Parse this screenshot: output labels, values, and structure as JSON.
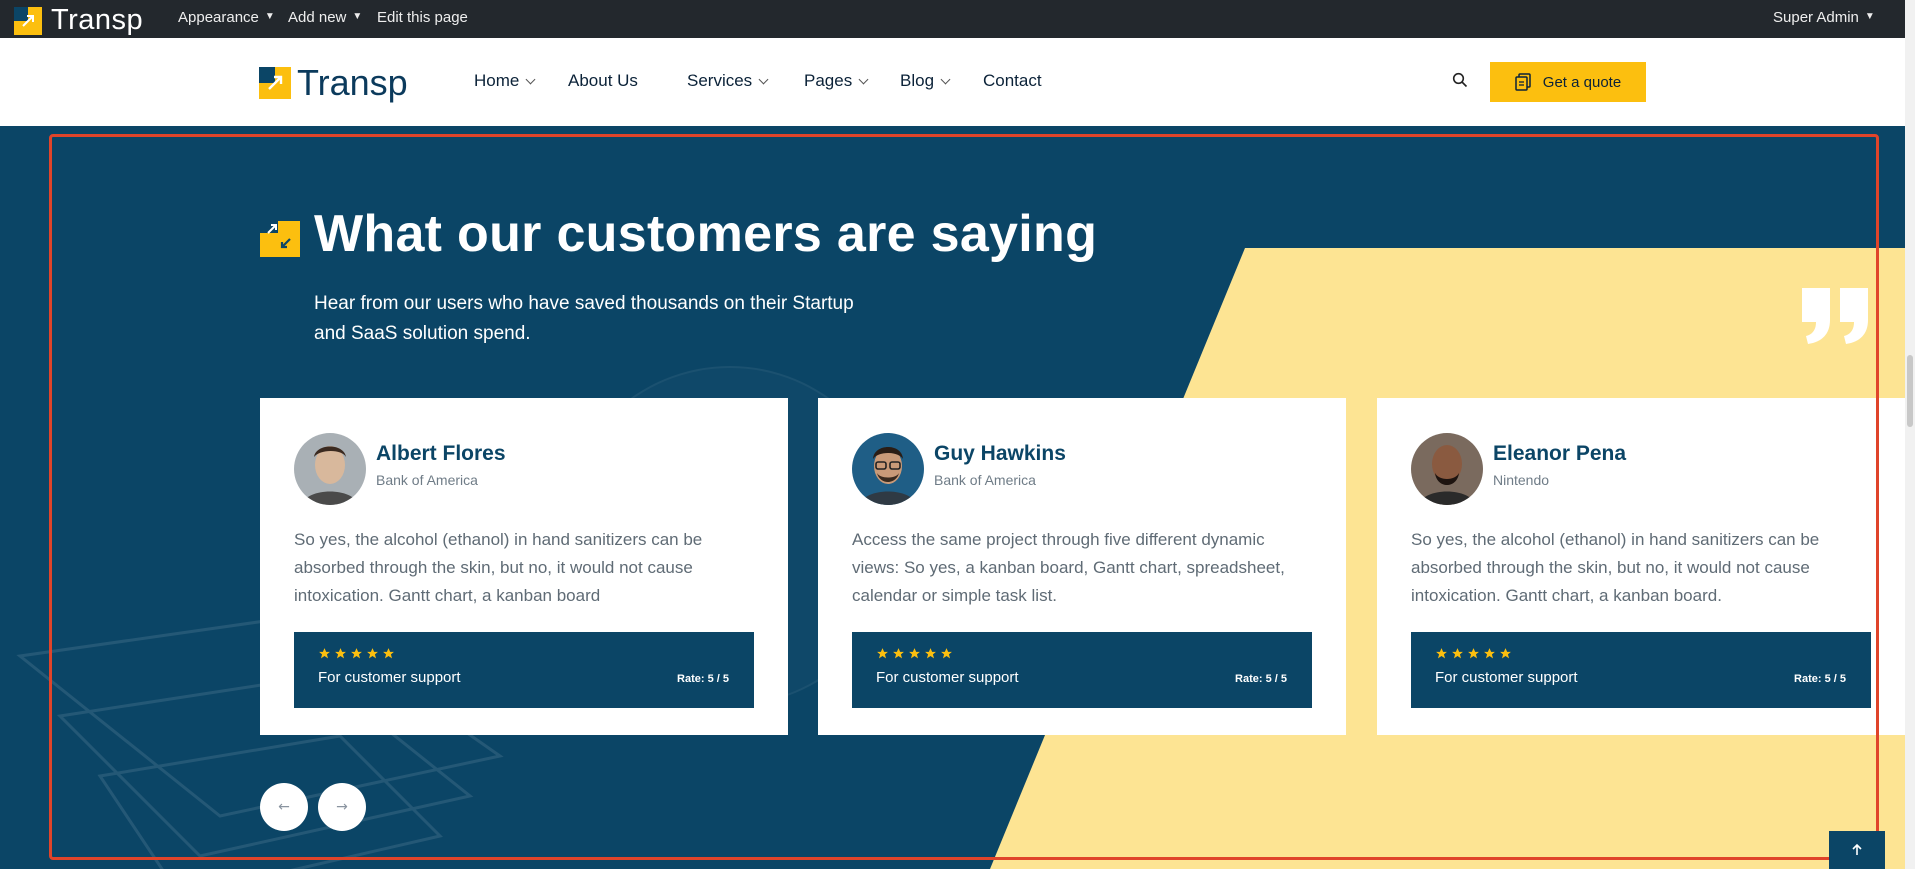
{
  "admin_bar": {
    "site_name": "Transp",
    "appearance": "Appearance",
    "add_new": "Add new",
    "edit_page": "Edit this page",
    "user": "Super Admin"
  },
  "header": {
    "brand": "Transp",
    "nav": [
      {
        "label": "Home"
      },
      {
        "label": "About Us"
      },
      {
        "label": "Services"
      },
      {
        "label": "Pages"
      },
      {
        "label": "Blog"
      },
      {
        "label": "Contact"
      }
    ],
    "quote_button": "Get a quote"
  },
  "section": {
    "title": "What our customers are saying",
    "subtitle": "Hear from our users who have saved thousands on their Startup and SaaS solution spend."
  },
  "testimonials": [
    {
      "name": "Albert Flores",
      "company": "Bank of America",
      "text": "So yes, the alcohol (ethanol) in hand sanitizers can be absorbed through the skin, but no, it would not cause intoxication. Gantt chart, a kanban board",
      "category": "For customer support",
      "rating_label": "Rate: 5 / 5",
      "stars": 5
    },
    {
      "name": "Guy Hawkins",
      "company": "Bank of America",
      "text": "Access the same project through five different dynamic views: So yes, a kanban board, Gantt chart, spreadsheet, calendar or simple task list.",
      "category": "For customer support",
      "rating_label": "Rate: 5 / 5",
      "stars": 5
    },
    {
      "name": "Eleanor Pena",
      "company": "Nintendo",
      "text": "So yes, the alcohol (ethanol) in hand sanitizers can be absorbed through the skin, but no, it would not cause intoxication. Gantt chart, a kanban board.",
      "category": "For customer support",
      "rating_label": "Rate: 5 / 5",
      "stars": 5
    }
  ],
  "colors": {
    "navy": "#0b4566",
    "yellow": "#fcbf0f",
    "pale_yellow": "#fde493",
    "highlight": "#e0442a"
  },
  "icons": {
    "search": "search-icon",
    "prev": "arrow-left-icon",
    "next": "arrow-right-icon",
    "back_to_top": "arrow-up-icon"
  }
}
